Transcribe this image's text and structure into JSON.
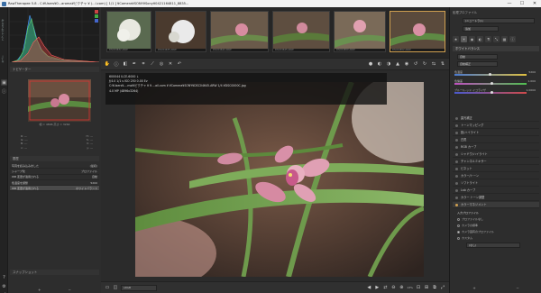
{
  "window": {
    "title": "RawTherapee 5.8 - C:¥Users¥0...aroma¥ピクチャ ¥ (...l.com) [ 1/1 ] ¥Camera¥SONY¥Sony¥0421164811_8835...",
    "minimize": "—",
    "maximize": "☐",
    "close": "✕"
  },
  "left_tabs": {
    "tab1": "ファイルブラウザ",
    "tab2": "キュー"
  },
  "left_panel": {
    "navigator_title": "ナビゲーター",
    "nav_caption": "幅 = 4896 高さ = 3264",
    "info_rows": [
      [
        "R: ---",
        "H: ---"
      ],
      [
        "G: ---",
        "S: ---"
      ],
      [
        "B: ---",
        "V: ---"
      ],
      [
        "x: ---",
        "y: ---"
      ]
    ],
    "history_title": "履歴",
    "history": [
      {
        "label": "写真を読み込みました",
        "value": "(最初)"
      },
      {
        "label": "シャープ化",
        "value": "プロファイル"
      },
      {
        "label": "WB 変更が適用される",
        "value": "自動"
      },
      {
        "label": "色温度を調整",
        "value": "5200"
      },
      {
        "label": "WB 変更が適用される",
        "value": "ホワイトバランス"
      }
    ],
    "snapshot_title": "スナップショット",
    "add_btn": "+",
    "remove_btn": "−"
  },
  "filmstrip": {
    "thumbs": [
      {
        "label": "DSC04632.ARW"
      },
      {
        "label": "DSC04635.ARW"
      },
      {
        "label": "DSC04642.ARW"
      },
      {
        "label": "DSC04645.ARW"
      },
      {
        "label": "DSC04650.ARW"
      },
      {
        "label": "DSC04652.ARW"
      }
    ]
  },
  "overlay": {
    "line1": "600044 ILCE-6000 ↓",
    "line2": "ƒ/4.0   1/1 s   ISO 250   0.00 Ev",
    "line3": "C:¥Users¥....moi¥ピクチャ ¥     ¥     ...ail.com ¥    ¥Camera¥SONY¥DSC04645.ARW  1/4 ¥DSC0000C.jpg",
    "line4": "4.0 MP (4896x3264)"
  },
  "bottom_toolbar": {
    "profile": "sRGB",
    "zoom": "13%"
  },
  "right_panel": {
    "title": "処理プロファイル",
    "profile_value": "(ニュートラル)",
    "mode_value": "追加",
    "wb_section": "ホワイトバランス",
    "wb_method": "自動",
    "wb_method2": "自動補正",
    "sliders": [
      {
        "label": "色温度",
        "value": "5200"
      },
      {
        "label": "色偏差",
        "value": "1.000"
      },
      {
        "label": "ブルー/レッド イコライザ",
        "value": "1.0000"
      }
    ],
    "sections": [
      "露光補正",
      "トーンマッピング",
      "影/ハイライト",
      "白黒",
      "RGB カーブ",
      "シャドウ/ハイライト",
      "チャンネルミキサー",
      "ビネット",
      "カラー/トーン",
      "ソフトライト",
      "Lab カーブ",
      "カラー トーン調整",
      "カラーマネジメント"
    ],
    "cm_subsection": "入力プロファイル",
    "radio_options": [
      "プロファイルなし",
      "カメラの標準",
      "カメラ固有のプロファイル",
      "カスタム"
    ],
    "custom_value": "(なし)",
    "add_btn": "+",
    "remove_btn": "−"
  },
  "colors": {
    "accent": "#d0a050",
    "panel_bg": "#2d2d2d",
    "background": "#2b2b2b"
  }
}
